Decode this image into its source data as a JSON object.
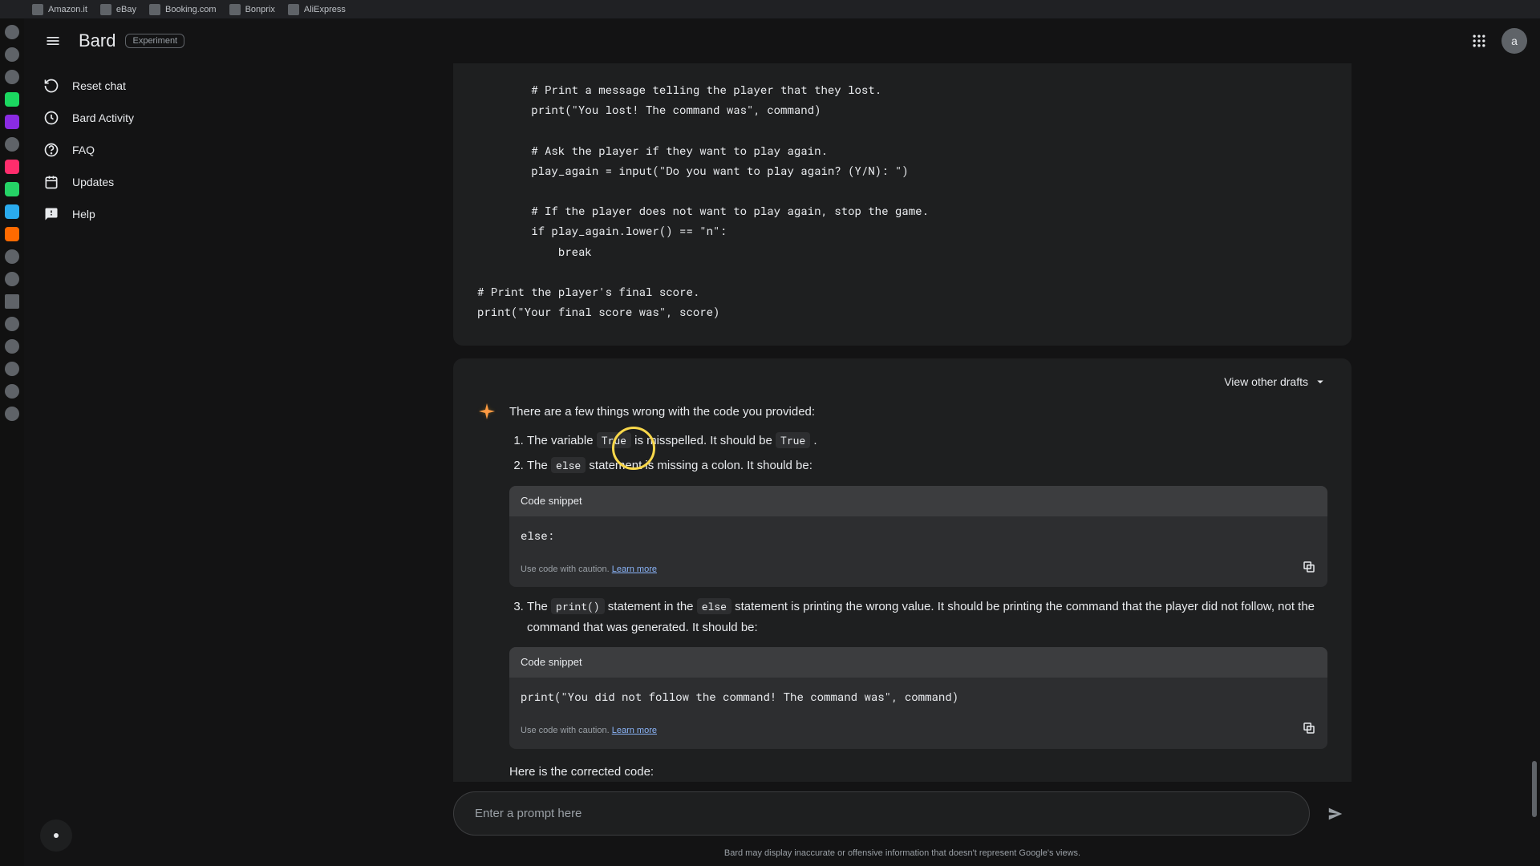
{
  "browserTabs": [
    {
      "label": "Amazon.it"
    },
    {
      "label": "eBay"
    },
    {
      "label": "Booking.com"
    },
    {
      "label": "Bonprix"
    },
    {
      "label": "AliExpress"
    }
  ],
  "header": {
    "brand": "Bard",
    "badge": "Experiment",
    "avatar": "a"
  },
  "nav": {
    "reset": "Reset chat",
    "activity": "Bard Activity",
    "faq": "FAQ",
    "updates": "Updates",
    "help": "Help"
  },
  "priorCode": "        # Print a message telling the player that they lost.\n        print(\"You lost! The command was\", command)\n\n        # Ask the player if they want to play again.\n        play_again = input(\"Do you want to play again? (Y/N): \")\n\n        # If the player does not want to play again, stop the game.\n        if play_again.lower() == \"n\":\n            break\n\n# Print the player's final score.\nprint(\"Your final score was\", score)",
  "viewDrafts": "View other drafts",
  "responseIntro": "There are a few things wrong with the code you provided:",
  "li1": {
    "a": "The variable ",
    "code": "True",
    "b": " is misspelled. It should be ",
    "code2": "True",
    "c": " ."
  },
  "li2": {
    "a": "The ",
    "code": "else",
    "b": " statement is missing a colon. It should be:"
  },
  "snippetLabel": "Code snippet",
  "snippet1": "else:",
  "cautionText": "Use code with caution. ",
  "learnMore": "Learn more",
  "li3": {
    "a": "The ",
    "code": "print()",
    "b": " statement in the ",
    "code2": "else",
    "c": " statement is printing the wrong value. It should be printing the command that the player did not follow, not the command that was generated. It should be:"
  },
  "snippet2": "print(\"You did not follow the command! The command was\", command)",
  "outro": "Here is the corrected code:",
  "inputPlaceholder": "Enter a prompt here",
  "disclaimer": "Bard may display inaccurate or offensive information that doesn't represent Google's views."
}
